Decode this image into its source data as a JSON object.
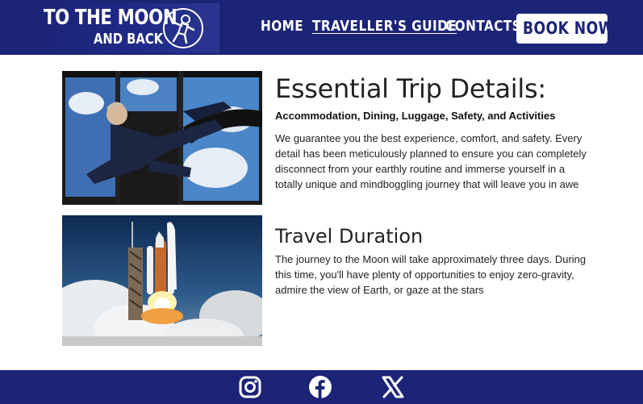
{
  "header": {
    "logo": {
      "line1": "TO THE MOON",
      "line2": "AND BACK",
      "icon": "astronaut-icon"
    },
    "nav": [
      {
        "label": "HOME",
        "active": false
      },
      {
        "label": "TRAVELLER'S GUIDE",
        "active": true
      },
      {
        "label": "CONTACTS",
        "active": false
      }
    ],
    "cta_label": "BOOK NOW!"
  },
  "sections": [
    {
      "title": "Essential Trip Details:",
      "subtitle": "Accommodation, Dining, Luggage, Safety, and Activities",
      "lines": [
        "We guarantee you the best experience, comfort, and safety. Every",
        "detail has been meticulously planned to ensure you can completely",
        "disconnect from your earthly routine and immerse yourself in a",
        "totally unique and mindboggling journey that will leave you in awe"
      ]
    },
    {
      "title": "Travel Duration",
      "lines": [
        "The journey to the Moon will take approximately three days. During",
        "this time, you'll have plenty of opportunities to enjoy zero-gravity,",
        "admire the view of Earth, or gaze at the stars"
      ]
    }
  ],
  "footer": {
    "social": [
      "instagram-icon",
      "facebook-icon",
      "x-icon"
    ]
  },
  "colors": {
    "brand": "#1b2477",
    "background": "#ffffff",
    "text": "#222222"
  }
}
